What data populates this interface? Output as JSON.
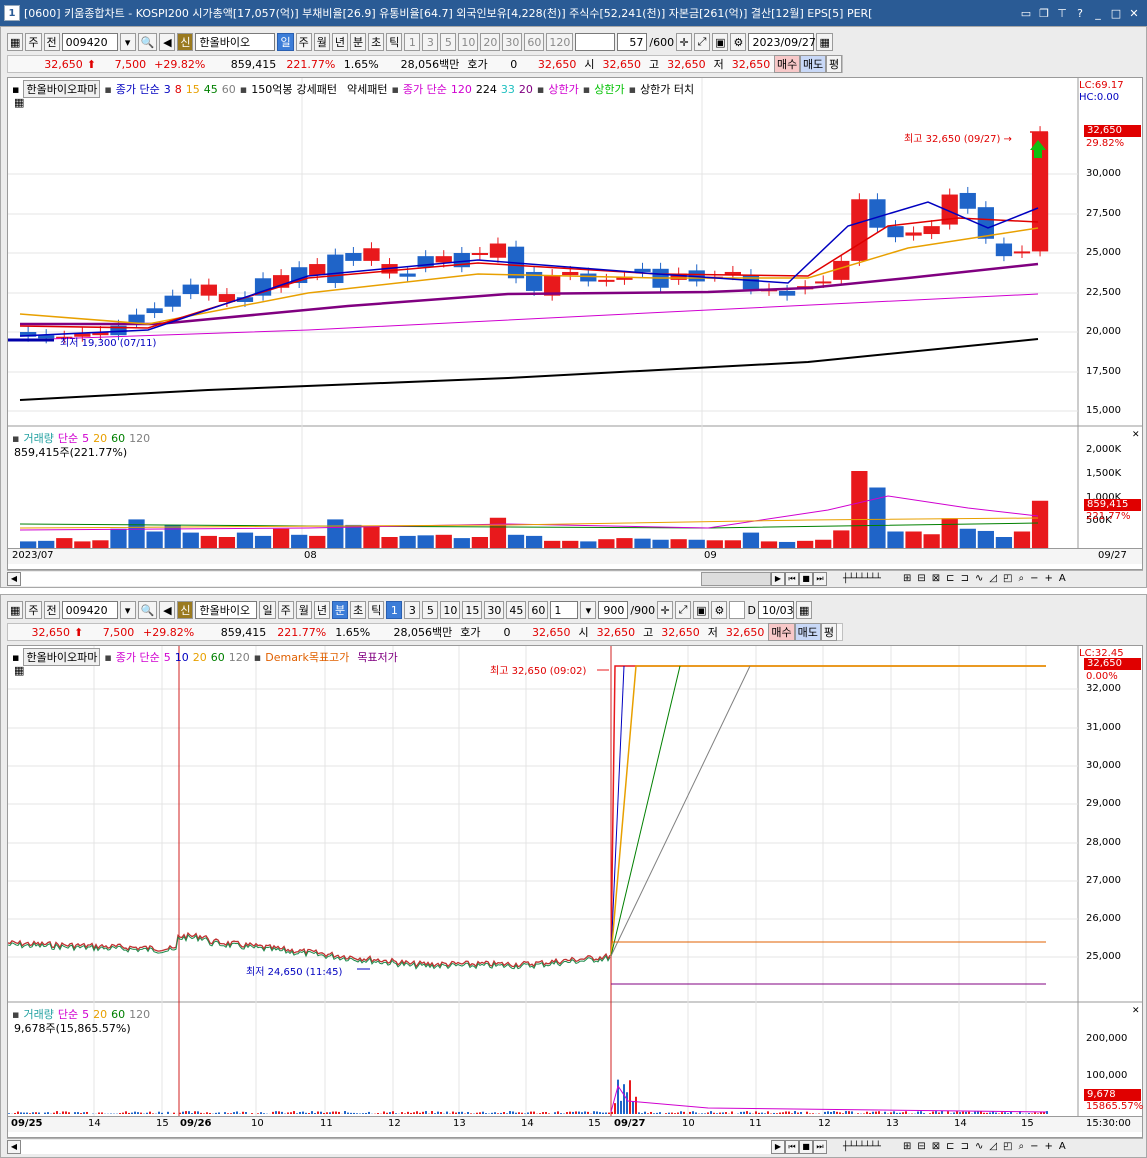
{
  "window": {
    "icon": "1",
    "title": "[0600] 키움종합차트 - KOSPI200 시가총액[17,057(억)] 부채비율[26.9] 유통비율[64.7] 외국인보유[4,228(천)] 주식수[52,241(천)] 자본금[261(억)] 결산[12월] EPS[5] PER["
  },
  "top": {
    "toolbar": {
      "btn1": "주",
      "btn2": "전",
      "code": "009420",
      "shin": "신",
      "name": "한올바이오",
      "periods": [
        "일",
        "주",
        "월",
        "년",
        "분",
        "초",
        "틱"
      ],
      "period_selected": "일",
      "nums": [
        "1",
        "3",
        "5",
        "10",
        "20",
        "30",
        "60",
        "120"
      ],
      "count": "57",
      "count_max": "/600",
      "date": "2023/09/27"
    },
    "quote": {
      "price": "32,650",
      "change": "7,500",
      "rate": "+29.82%",
      "volume": "859,415",
      "vol_rate": "221.77%",
      "turnover": "1.65%",
      "amount": "28,056백만",
      "hoga_label": "호가",
      "hoga": "0",
      "price2": "32,650",
      "open_label": "시",
      "open": "32,650",
      "high_label": "고",
      "high": "32,650",
      "low_label": "저",
      "low": "32,650",
      "buy": "매수",
      "sell": "매도",
      "eval": "평"
    },
    "legend": {
      "name": "한올바이오파마",
      "ma_label": "종가 단순",
      "ma": [
        "3",
        "8",
        "15",
        "45",
        "60"
      ],
      "v150": "150억봉",
      "strong": "강세패턴",
      "weak": "약세패턴",
      "ma2_label": "종가 단순",
      "ma2": [
        "120",
        "224",
        "33",
        "20"
      ],
      "upper1": "상한가",
      "upper2": "상한가",
      "upper_touch": "상한가 터치"
    },
    "lc": "LC:69.17",
    "hc": "HC:0.00",
    "price_tag": "32,650",
    "pct_tag": "29.82%",
    "high_note": "최고 32,650 (09/27) →",
    "low_note": "최저 19,300 (07/11)",
    "y_ticks": [
      "30,000",
      "27,500",
      "25,000",
      "22,500",
      "20,000",
      "17,500",
      "15,000"
    ],
    "volume": {
      "legend_label": "거래량",
      "legend_ma": "단순",
      "ma": [
        "5",
        "20",
        "60",
        "120"
      ],
      "value": "859,415주(221.77%)",
      "y_ticks": [
        "2,000K",
        "1,500K",
        "1,000K",
        "500K"
      ],
      "tag": "859,415",
      "tag_pct": "221.77%"
    },
    "x_ticks": [
      "2023/07",
      "08",
      "09"
    ],
    "x_last": "09/27"
  },
  "bottom": {
    "toolbar": {
      "btn1": "주",
      "btn2": "전",
      "code": "009420",
      "shin": "신",
      "name": "한올바이오",
      "periods": [
        "일",
        "주",
        "월",
        "년",
        "분",
        "초",
        "틱"
      ],
      "period_selected": "분",
      "nums": [
        "1",
        "3",
        "5",
        "10",
        "15",
        "30",
        "45",
        "60"
      ],
      "num_selected": "1",
      "interval": "1",
      "count": "900",
      "count_max": "/900",
      "d_label": "D",
      "date": "10/03"
    },
    "quote": {
      "price": "32,650",
      "change": "7,500",
      "rate": "+29.82%",
      "volume": "859,415",
      "vol_rate": "221.77%",
      "turnover": "1.65%",
      "amount": "28,056백만",
      "hoga_label": "호가",
      "hoga": "0",
      "price2": "32,650",
      "open_label": "시",
      "open": "32,650",
      "high_label": "고",
      "high": "32,650",
      "low_label": "저",
      "low": "32,650",
      "buy": "매수",
      "sell": "매도",
      "eval": "평"
    },
    "legend": {
      "name": "한올바이오파마",
      "ma_label": "종가 단순",
      "ma": [
        "5",
        "10",
        "20",
        "60",
        "120"
      ],
      "demark": "Demark목표고가",
      "target_low": "목표저가"
    },
    "lc": "LC:32.45",
    "price_tag": "32,650",
    "pct_tag": "0.00%",
    "high_note": "최고 32,650 (09:02)",
    "low_note": "최저 24,650 (11:45)",
    "y_ticks": [
      "32,000",
      "31,000",
      "30,000",
      "29,000",
      "28,000",
      "27,000",
      "26,000",
      "25,000"
    ],
    "volume": {
      "legend_label": "거래량",
      "legend_ma": "단순",
      "ma": [
        "5",
        "20",
        "60",
        "120"
      ],
      "value": "9,678주(15,865.57%)",
      "y_ticks": [
        "200,000",
        "100,000"
      ],
      "tag": "9,678",
      "tag_pct": "15865.57%"
    },
    "x_ticks": [
      "09/25",
      "14",
      "15",
      "09/26",
      "10",
      "11",
      "12",
      "13",
      "14",
      "15",
      "09/27",
      "10",
      "11",
      "12",
      "13",
      "14",
      "15"
    ],
    "x_last": "15:30:00"
  },
  "colors": {
    "up": "#e8191c",
    "down": "#1f64c8",
    "accent": "#2a5b95"
  }
}
